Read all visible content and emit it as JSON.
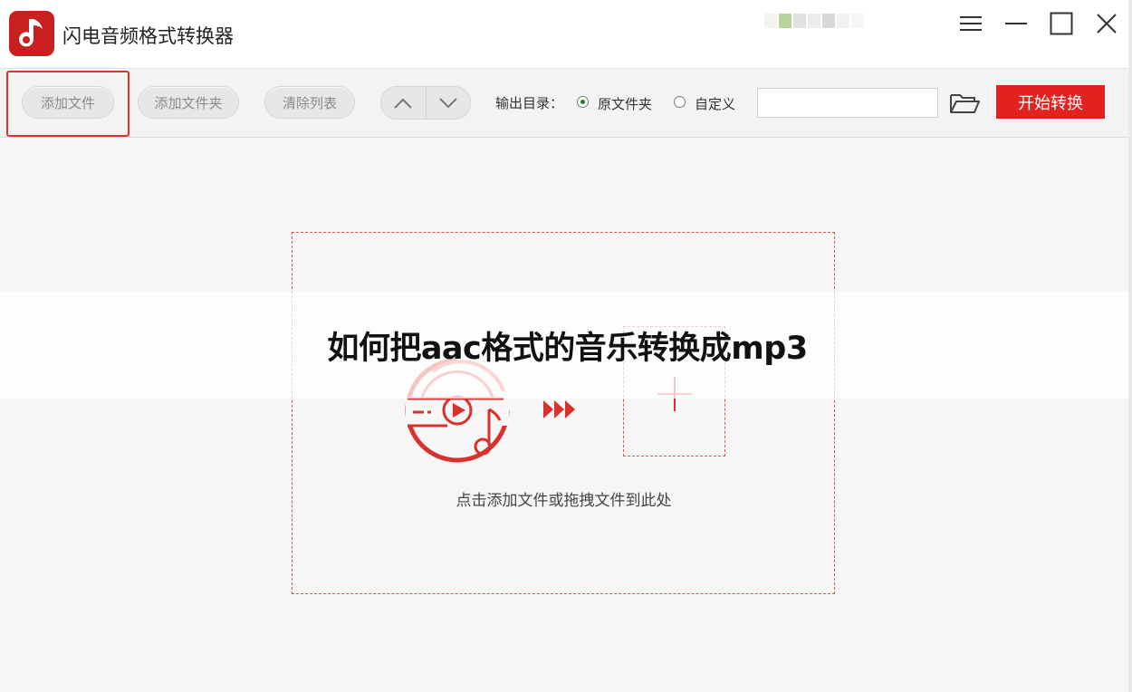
{
  "window": {
    "title": "闪电音频格式转换器",
    "menu_icon": "menu-icon",
    "minimize_icon": "minimize-icon",
    "maximize_icon": "maximize-icon",
    "close_icon": "close-icon"
  },
  "toolbar": {
    "add_file_label": "添加文件",
    "add_folder_label": "添加文件夹",
    "clear_list_label": "清除列表",
    "move_up_icon": "chevron-up-icon",
    "move_down_icon": "chevron-down-icon",
    "output_dir_label": "输出目录：",
    "radio_original_label": "原文件夹",
    "radio_original_checked": true,
    "radio_custom_label": "自定义",
    "radio_custom_checked": false,
    "path_value": "",
    "path_placeholder": "",
    "folder_icon": "folder-open-icon",
    "start_label": "开始转换"
  },
  "drop_zone": {
    "hint": "点击添加文件或拖拽文件到此处",
    "music_icon": "music-disc-icon",
    "arrow_icon": "fast-forward-icon",
    "add_icon": "plus-icon"
  },
  "overlay": {
    "title": "如何把aac格式的音乐转换成mp3"
  },
  "colors": {
    "accent": "#e3211f",
    "highlight_border": "#e1312c",
    "dashed_border": "#d9534f"
  }
}
